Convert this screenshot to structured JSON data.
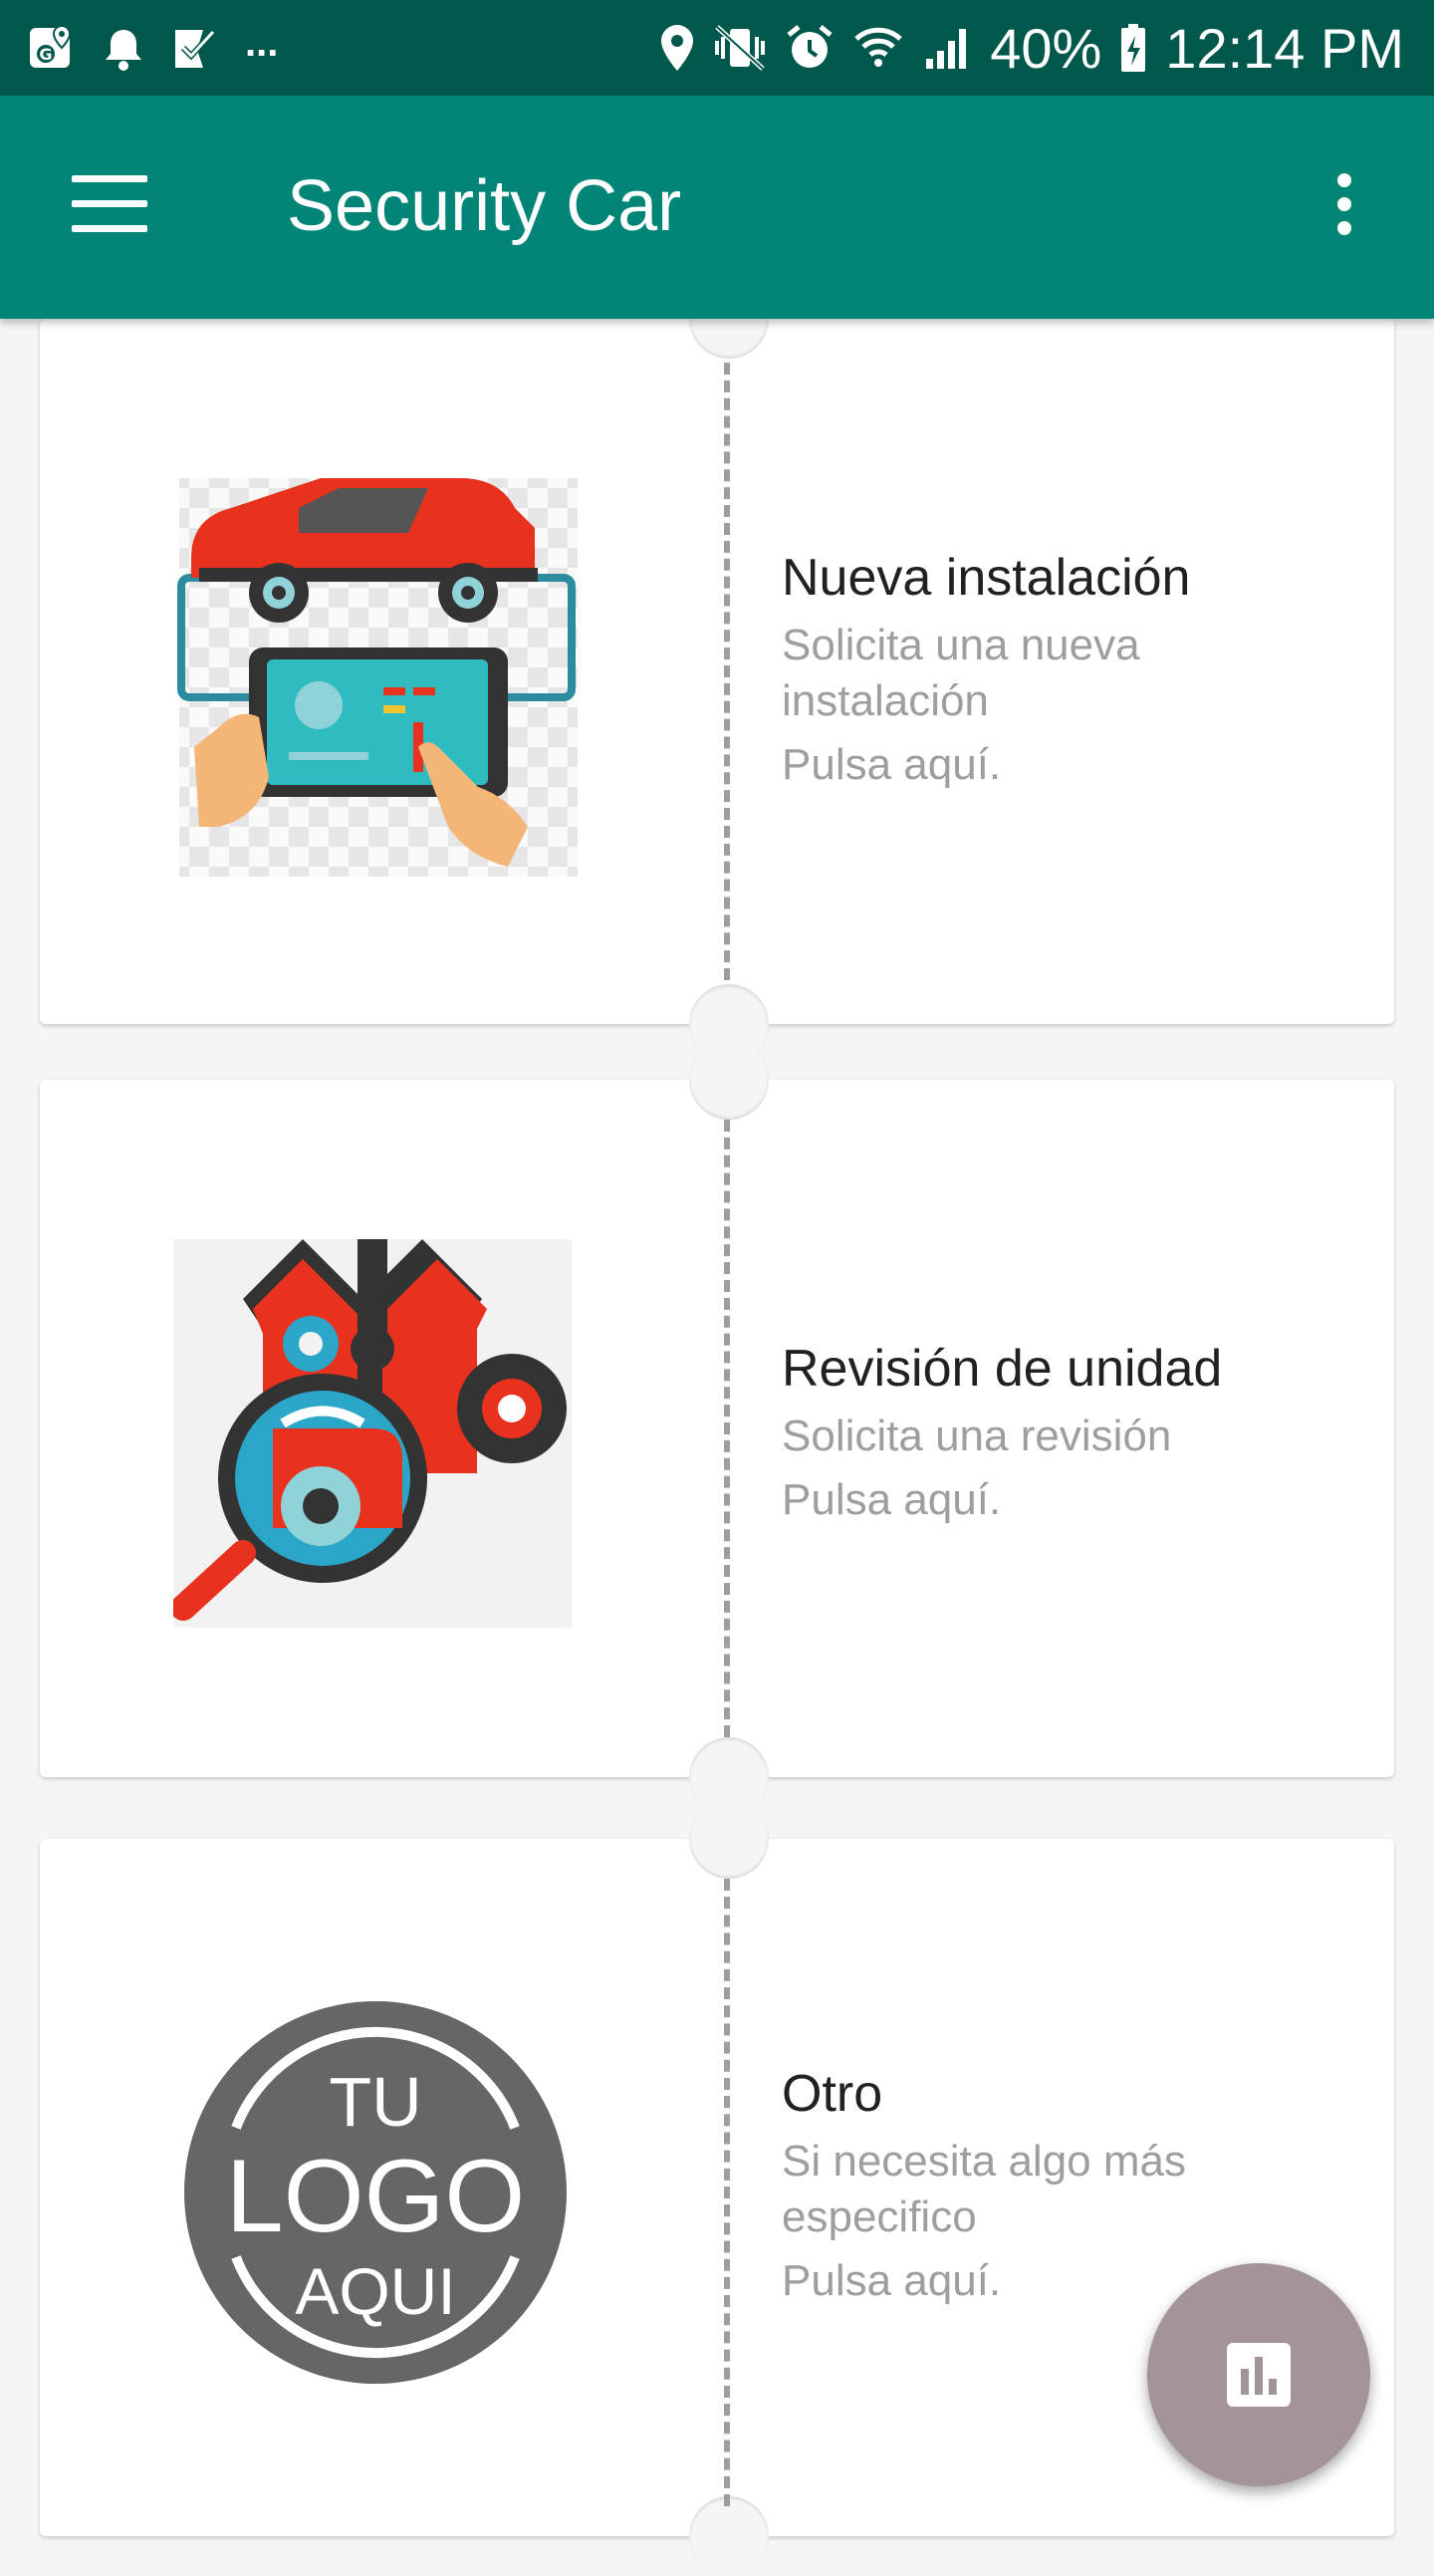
{
  "status_bar": {
    "left_icons": [
      "maps-icon",
      "notification-bell-icon",
      "task-check-icon"
    ],
    "overflow": "...",
    "right_icons": [
      "location-icon",
      "vibrate-icon",
      "alarm-icon",
      "wifi-icon",
      "signal-icon"
    ],
    "battery_percent": "40%",
    "time": "12:14 PM"
  },
  "app_bar": {
    "title": "Security Car",
    "menu_icon": "hamburger-menu-icon",
    "overflow_icon": "more-vert-icon"
  },
  "cards": [
    {
      "title": "Nueva instalación",
      "description": "Solicita una nueva instalación",
      "action": "Pulsa aquí.",
      "image": "car-installation-illustration"
    },
    {
      "title": "Revisión de unidad",
      "description": "Solicita una revisión",
      "action": "Pulsa aquí.",
      "image": "engine-inspection-illustration"
    },
    {
      "title": "Otro",
      "description": "Si necesita algo más especifico",
      "action": "Pulsa aquí.",
      "image": "placeholder-logo",
      "logo_text": [
        "TU",
        "LOGO",
        "AQUI"
      ]
    }
  ],
  "fab": {
    "icon": "bar-chart-icon"
  },
  "colors": {
    "status_bar": "#00574b",
    "app_bar": "#008577",
    "fab": "#a29499",
    "title_text": "#212121",
    "secondary_text": "#9e9e9e"
  }
}
